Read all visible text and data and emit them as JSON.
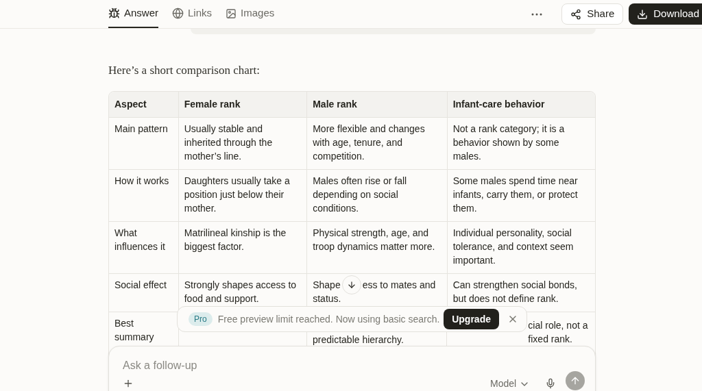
{
  "tabs": [
    {
      "label": "Answer",
      "selected": true
    },
    {
      "label": "Links",
      "selected": false
    },
    {
      "label": "Images",
      "selected": false
    }
  ],
  "actions": {
    "share": "Share",
    "download": "Download"
  },
  "intro": "Here’s a short comparison chart:",
  "table": {
    "columns": [
      "Aspect",
      "Female rank",
      "Male rank",
      "Infant-care behavior"
    ],
    "rows": [
      {
        "cells": [
          {
            "text": "Main pattern"
          },
          {
            "text": "Usually stable and inherited through the mother’s line."
          },
          {
            "text": "More flexible and changes with age, tenure, and competition."
          },
          {
            "text": "Not a rank category; it is a behavior shown by some males."
          }
        ]
      },
      {
        "cells": [
          {
            "text": "How it works"
          },
          {
            "text": "Daughters usually take a position just below their mother."
          },
          {
            "text": "Males often rise or fall depending on social conditions."
          },
          {
            "text": "Some males spend time near infants, carry them, or protect them."
          }
        ]
      },
      {
        "cells": [
          {
            "text": "What influences it"
          },
          {
            "text": "Matrilineal kinship is the biggest factor."
          },
          {
            "text": "Physical strength, age, and troop dynamics matter more."
          },
          {
            "text": "Individual personality, social tolerance, and context seem important."
          }
        ]
      },
      {
        "cells": [
          {
            "text": "Social effect"
          },
          {
            "text": "Strongly shapes access to food and support."
          },
          {
            "parts": [
              "Shape",
              "ess to mates and",
              "status."
            ]
          },
          {
            "text": "Can strengthen social bonds, but does not define rank."
          }
        ]
      },
      {
        "cells": [
          {
            "text": "Best summary"
          },
          {},
          {
            "lower": "predictable hierarchy."
          },
          {
            "text": "cial role, not a fixed rank."
          }
        ]
      }
    ]
  },
  "toast": {
    "badge": "Pro",
    "message": "Free preview limit reached. Now using basic search.",
    "button": "Upgrade"
  },
  "composer": {
    "placeholder": "Ask a follow-up",
    "model": "Model"
  }
}
